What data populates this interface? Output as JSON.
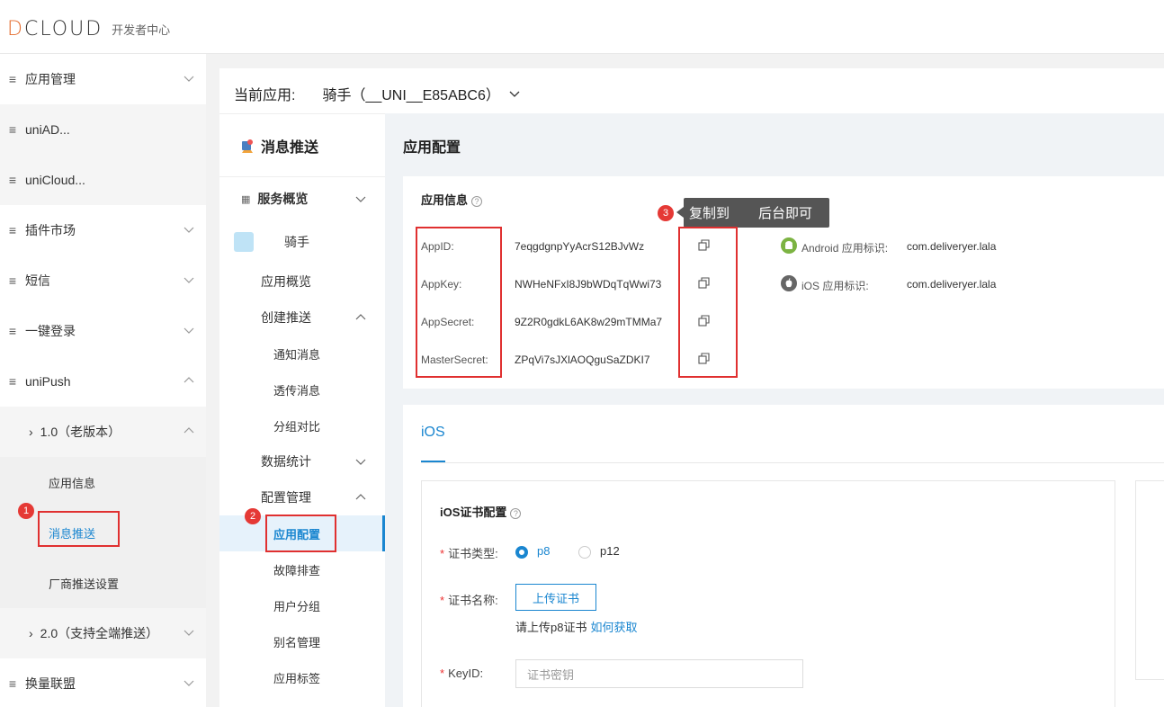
{
  "header": {
    "logo": "DCLOUD",
    "subtitle": "开发者中心"
  },
  "sidebar": {
    "items": [
      {
        "label": "应用管理"
      },
      {
        "label": "uniAD..."
      },
      {
        "label": "uniCloud..."
      },
      {
        "label": "插件市场"
      },
      {
        "label": "短信"
      },
      {
        "label": "一键登录"
      },
      {
        "label": "uniPush"
      }
    ],
    "push_v1": "1.0（老版本）",
    "app_info": "应用信息",
    "msg_push": "消息推送",
    "vendor_setting": "厂商推送设置",
    "push_v2": "2.0（支持全端推送）",
    "exchange": "换量联盟"
  },
  "current_app": {
    "label": "当前应用:",
    "value": "骑手（__UNI__E85ABC6）"
  },
  "nav2": {
    "title": "消息推送",
    "service_overview": "服务概览",
    "app_name": "骑手",
    "app_overview": "应用概览",
    "create_push": "创建推送",
    "notify_msg": "通知消息",
    "transparent_msg": "透传消息",
    "group_compare": "分组对比",
    "data_stats": "数据统计",
    "config_mgmt": "配置管理",
    "app_config": "应用配置",
    "troubleshoot": "故障排查",
    "user_group": "用户分组",
    "alias_mgmt": "别名管理",
    "app_tags": "应用标签"
  },
  "content": {
    "title": "应用配置",
    "info_title": "应用信息",
    "keys": [
      {
        "label": "AppID:",
        "value": "7eqgdgnpYyAcrS12BJvWz"
      },
      {
        "label": "AppKey:",
        "value": "NWHeNFxI8J9bWDqTqWwi73"
      },
      {
        "label": "AppSecret:",
        "value": "9Z2R0gdkL6AK8w29mTMMa7"
      },
      {
        "label": "MasterSecret:",
        "value": "ZPqVi7sJXlAOQguSaZDKI7"
      }
    ],
    "android_label": "Android 应用标识:",
    "android_value": "com.deliveryer.lala",
    "ios_label": "iOS 应用标识:",
    "ios_value": "com.deliveryer.lala",
    "tab_ios": "iOS",
    "cert_title": "iOS证书配置",
    "cert_type_label": "证书类型:",
    "cert_type_options": [
      "p8",
      "p12"
    ],
    "cert_type_selected": "p8",
    "cert_name_label": "证书名称:",
    "upload_btn": "上传证书",
    "hint": "请上传p8证书",
    "hint_link": "如何获取",
    "keyid_label": "KeyID:",
    "keyid_placeholder": "证书密钥"
  },
  "tooltip": {
    "left": "复制到",
    "right": "后台即可"
  },
  "badges": [
    "1",
    "2",
    "3"
  ],
  "colors": {
    "accent": "#1a86d0",
    "annotation": "#e03030",
    "logo_d": "#e46b2c"
  }
}
